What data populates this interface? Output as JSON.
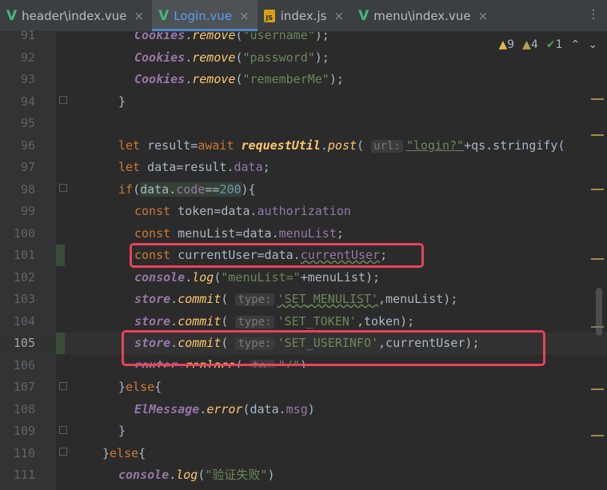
{
  "tabs": [
    {
      "label": "header\\index.vue",
      "icon": "vue-icon",
      "active": false
    },
    {
      "label": "Login.vue",
      "icon": "vue-icon",
      "active": true
    },
    {
      "label": "index.js",
      "icon": "js-file-icon",
      "active": false
    },
    {
      "label": "menu\\index.vue",
      "icon": "vue-icon",
      "active": false
    }
  ],
  "tab_more": "⋮",
  "inspections": {
    "warnings": "9",
    "weak_warnings": "4",
    "ok": "1"
  },
  "gutter": {
    "line_numbers": [
      "91",
      "92",
      "93",
      "94",
      "95",
      "96",
      "97",
      "98",
      "99",
      "100",
      "101",
      "102",
      "103",
      "104",
      "105",
      "106",
      "107",
      "108",
      "109",
      "110",
      "111"
    ],
    "current_line": "105"
  },
  "hints": {
    "url": "url:",
    "type": "type:",
    "to": "to:"
  },
  "code": {
    "l91_obj": "Cookies",
    "l91_m": "remove",
    "l91_s": "\"username\"",
    "l92_obj": "Cookies",
    "l92_m": "remove",
    "l92_s": "\"password\"",
    "l93_obj": "Cookies",
    "l93_m": "remove",
    "l93_s": "\"rememberMe\"",
    "l96_kw": "let",
    "l96_var": " result=",
    "l96_await": "await",
    "l96_fn": "requestUtil",
    "l96_m": "post",
    "l96_s": "\"login?\"",
    "l96_tail": "+qs.stringify(",
    "l97_kw": "let",
    "l97_var": " data=result.",
    "l97_p": "data",
    "l98_kw": "if",
    "l98_a": "data",
    "l98_p": "code",
    "l98_n": "200",
    "l99_kw": "const",
    "l99_v": " token=data.",
    "l99_p": "authorization",
    "l100_kw": "const",
    "l100_v": " menuList=data.",
    "l100_p": "menuList",
    "l101_kw": "const",
    "l101_v": " currentUser=data.",
    "l101_p": "currentUser",
    "l102_obj": "console",
    "l102_m": "log",
    "l102_s": "\"menuList=\"",
    "l102_t": "+menuList)",
    "l103_obj": "store",
    "l103_m": "commit",
    "l103_s": "'SET_MENULIST'",
    "l103_t": ",menuList)",
    "l104_obj": "store",
    "l104_m": "commit",
    "l104_s": "'SET_TOKEN'",
    "l104_t": ",token)",
    "l105_obj": "store",
    "l105_m": "commit",
    "l105_s": "'SET_USERINFO'",
    "l105_t": ",currentUser)",
    "l106_obj": "router",
    "l106_m": "replace",
    "l106_s": "\"/\"",
    "l107_kw": "else",
    "l108_fn": "ElMessage",
    "l108_m": "error",
    "l108_a": "(data.",
    "l108_p": "msg",
    "l110_kw": "else",
    "l111_obj": "console",
    "l111_m": "log",
    "l111_s": "\"验证失败\""
  },
  "colors": {
    "accent": "#4a88c7",
    "highlight_box": "#e8435c"
  }
}
